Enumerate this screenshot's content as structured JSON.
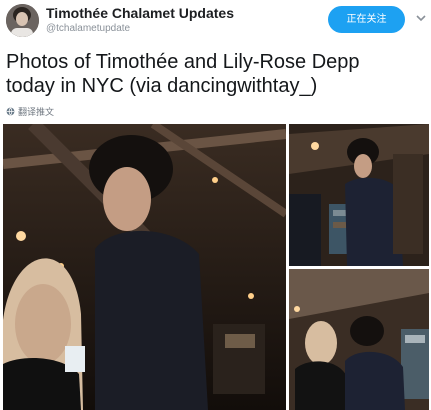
{
  "tweet": {
    "display_name": "Timothée Chalamet Updates",
    "handle": "@tchalametupdate",
    "follow_button_label": "正在关注",
    "text_line1": "Photos of Timothée and Lily-Rose Depp",
    "text_line2": "today in NYC (via dancingwithtay_)",
    "translate_label": "翻译推文"
  },
  "icons": {
    "avatar": "avatar-photo",
    "dropdown": "chevron-down-icon",
    "translate": "globe-icon"
  },
  "colors": {
    "follow_button": "#1da1f2",
    "name_text": "#14171a",
    "handle_text": "#8a9199"
  },
  "photos": [
    {
      "name": "main-photo"
    },
    {
      "name": "top-right-photo"
    },
    {
      "name": "bottom-right-photo"
    }
  ]
}
